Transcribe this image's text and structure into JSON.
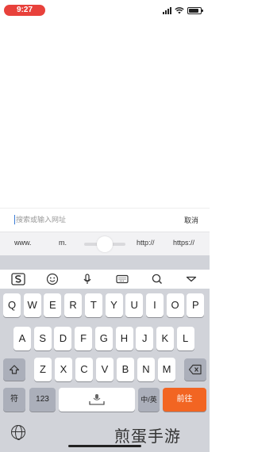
{
  "status_bar": {
    "time": "9:27",
    "time_color": "#e8413b",
    "battery_percent": 85
  },
  "search": {
    "placeholder": "搜索或输入网址",
    "cancel_label": "取消"
  },
  "url_shortcuts": [
    "www.",
    "m.",
    "http://",
    "https://"
  ],
  "toolbar": {
    "icons": [
      "sogou-s-icon",
      "emoji-icon",
      "microphone-icon",
      "keyboard-icon",
      "search-icon",
      "collapse-icon"
    ]
  },
  "keyboard": {
    "row1": [
      "Q",
      "W",
      "E",
      "R",
      "T",
      "Y",
      "U",
      "I",
      "O",
      "P"
    ],
    "row2": [
      "A",
      "S",
      "D",
      "F",
      "G",
      "H",
      "J",
      "K",
      "L"
    ],
    "row3": [
      "Z",
      "X",
      "C",
      "V",
      "B",
      "N",
      "M"
    ],
    "symbols_label": "符",
    "numbers_label": "123",
    "lang_label": "中/英",
    "go_label": "前往"
  },
  "watermark": "煎蛋手游",
  "colors": {
    "accent": "#f26522"
  }
}
